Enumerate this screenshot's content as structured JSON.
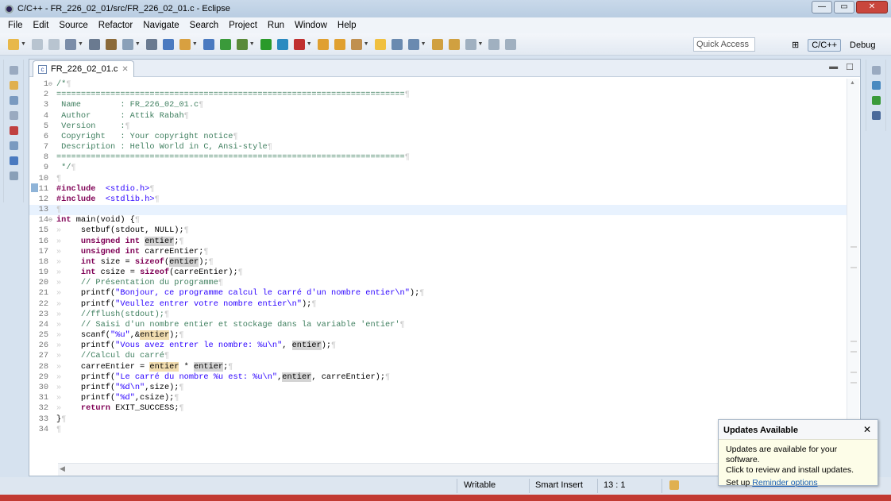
{
  "window": {
    "title": "C/C++ - FR_226_02_01/src/FR_226_02_01.c - Eclipse",
    "buttons": [
      "—",
      "▭",
      "✕"
    ]
  },
  "menu": [
    "File",
    "Edit",
    "Source",
    "Refactor",
    "Navigate",
    "Search",
    "Project",
    "Run",
    "Window",
    "Help"
  ],
  "toolbar": {
    "quick_access": "Quick Access",
    "perspectives": [
      {
        "label": "C/C++",
        "active": true
      },
      {
        "label": "Debug",
        "active": false
      }
    ],
    "icon_colors": [
      "#e8b84a",
      "#b8c4d0",
      "#b8c4d0",
      "#7a8ca8",
      "#6a7a90",
      "#8b6a3a",
      "#8aa0b8",
      "#6a7a90",
      "#4a7ac0",
      "#d8a040",
      "#4a7ac0",
      "#3a9a3a",
      "#5a8a3a",
      "#2a9a2a",
      "#2a8ac0",
      "#c03030",
      "#e0a030",
      "#e0a030",
      "#c09050",
      "#f0c040",
      "#6a8ab0",
      "#6a8ab0",
      "#d0a040",
      "#d0a040",
      "#a0b0c0",
      "#a0b0c0",
      "#a0b0c0"
    ]
  },
  "editor": {
    "tab_label": "FR_226_02_01.c",
    "tab_close": "✕",
    "current_line": 13,
    "lines": [
      [
        [
          "com",
          "/*"
        ]
      ],
      [
        [
          "com",
          "======================================================================="
        ]
      ],
      [
        [
          "com",
          " Name        : FR_226_02_01.c"
        ]
      ],
      [
        [
          "com",
          " Author      : Attik Rabah"
        ]
      ],
      [
        [
          "com",
          " Version     :"
        ]
      ],
      [
        [
          "com",
          " Copyright   : Your copyright notice"
        ]
      ],
      [
        [
          "com",
          " Description : Hello World in C, Ansi-style"
        ]
      ],
      [
        [
          "com",
          "======================================================================="
        ]
      ],
      [
        [
          "com",
          " */"
        ]
      ],
      [],
      [
        [
          "kw",
          "#include"
        ],
        [
          "",
          "  "
        ],
        [
          "str",
          "<stdio.h>"
        ]
      ],
      [
        [
          "kw",
          "#include"
        ],
        [
          "",
          "  "
        ],
        [
          "str",
          "<stdlib.h>"
        ]
      ],
      [],
      [
        [
          "kw",
          "int"
        ],
        [
          "",
          " main(void) {"
        ]
      ],
      [
        [
          "tab",
          ""
        ],
        [
          "",
          " setbuf(stdout, NULL);"
        ]
      ],
      [
        [
          "tab",
          ""
        ],
        [
          "kw",
          " unsigned int"
        ],
        [
          "",
          " "
        ],
        [
          "occ",
          "entier"
        ],
        [
          "",
          ";"
        ]
      ],
      [
        [
          "tab",
          ""
        ],
        [
          "kw",
          " unsigned int"
        ],
        [
          "",
          " carreEntier;"
        ]
      ],
      [
        [
          "tab",
          ""
        ],
        [
          "kw",
          " int"
        ],
        [
          "",
          " size = "
        ],
        [
          "kw",
          "sizeof"
        ],
        [
          "",
          "("
        ],
        [
          "occ",
          "entier"
        ],
        [
          "",
          ");"
        ]
      ],
      [
        [
          "tab",
          ""
        ],
        [
          "kw",
          " int"
        ],
        [
          "",
          " csize = "
        ],
        [
          "kw",
          "sizeof"
        ],
        [
          "",
          "(carreEntier);"
        ]
      ],
      [
        [
          "tab",
          ""
        ],
        [
          "com",
          " // Présentation du programme"
        ]
      ],
      [
        [
          "tab",
          ""
        ],
        [
          "",
          " printf("
        ],
        [
          "str",
          "\"Bonjour, ce programme calcul le carré d'un nombre entier\\n\""
        ],
        [
          "",
          ");"
        ]
      ],
      [
        [
          "tab",
          ""
        ],
        [
          "",
          " printf("
        ],
        [
          "str",
          "\"Veullez entrer votre nombre entier\\n\""
        ],
        [
          "",
          ");"
        ]
      ],
      [
        [
          "tab",
          ""
        ],
        [
          "com",
          " //fflush(stdout);"
        ]
      ],
      [
        [
          "tab",
          ""
        ],
        [
          "com",
          " // Saisi d'un nombre entier et stockage dans la variable 'entier'"
        ]
      ],
      [
        [
          "tab",
          ""
        ],
        [
          "",
          " scanf("
        ],
        [
          "str",
          "\"%u\""
        ],
        [
          "",
          ",&"
        ],
        [
          "wocc",
          "entier"
        ],
        [
          "",
          ");"
        ]
      ],
      [
        [
          "tab",
          ""
        ],
        [
          "",
          " printf("
        ],
        [
          "str",
          "\"Vous avez entrer le nombre: %u\\n\""
        ],
        [
          "",
          ", "
        ],
        [
          "occ",
          "entier"
        ],
        [
          "",
          ");"
        ]
      ],
      [
        [
          "tab",
          ""
        ],
        [
          "com",
          " //Calcul du carré"
        ]
      ],
      [
        [
          "tab",
          ""
        ],
        [
          "",
          " carreEntier = "
        ],
        [
          "wocc",
          "entier"
        ],
        [
          "",
          " * "
        ],
        [
          "occ",
          "entier"
        ],
        [
          "",
          ";"
        ]
      ],
      [
        [
          "tab",
          ""
        ],
        [
          "",
          " printf("
        ],
        [
          "str",
          "\"Le carré du nombre %u est: %u\\n\""
        ],
        [
          "",
          ","
        ],
        [
          "occ",
          "entier"
        ],
        [
          "",
          ", carreEntier);"
        ]
      ],
      [
        [
          "tab",
          ""
        ],
        [
          "",
          " printf("
        ],
        [
          "str",
          "\"%d\\n\""
        ],
        [
          "",
          ",size);"
        ]
      ],
      [
        [
          "tab",
          ""
        ],
        [
          "",
          " printf("
        ],
        [
          "str",
          "\"%d\""
        ],
        [
          "",
          ",csize);"
        ]
      ],
      [
        [
          "tab",
          ""
        ],
        [
          "kw",
          " return"
        ],
        [
          "",
          " EXIT_SUCCESS;"
        ]
      ],
      [
        [
          "",
          "}"
        ]
      ],
      []
    ]
  },
  "status": {
    "writable": "Writable",
    "insert_mode": "Smart Insert",
    "position": "13 : 1"
  },
  "popup": {
    "title": "Updates Available",
    "close": "✕",
    "line1": "Updates are available for your software.",
    "line2": "Click to review and install updates.",
    "setup_prefix": "Set up ",
    "link": "Reminder options"
  }
}
